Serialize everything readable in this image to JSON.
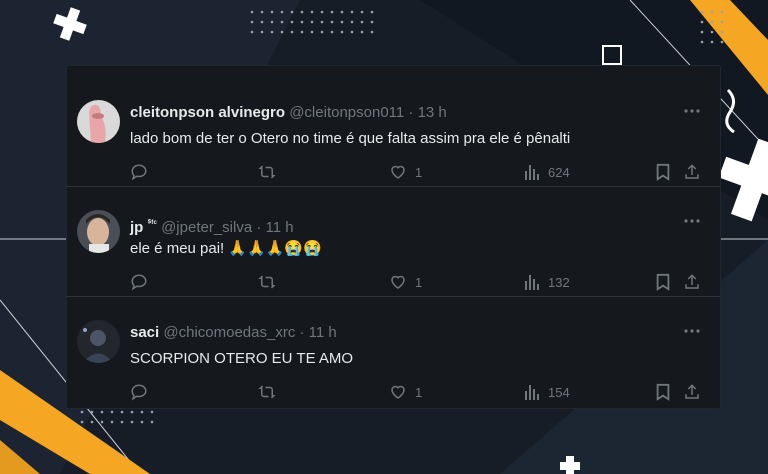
{
  "tweets": [
    {
      "name": "cleitonpson alvinegro",
      "name_suffix": "",
      "handle": "@cleitonpson011",
      "separator": "·",
      "time": "13 h",
      "text": "lado bom de ter o Otero no time é que falta assim pra ele é pênalti",
      "likes": "1",
      "views": "624"
    },
    {
      "name": "jp",
      "name_suffix": "ᔆᶠᶜ",
      "handle": "@jpeter_silva",
      "separator": "·",
      "time": "11 h",
      "text": "ele é meu pai! 🙏🙏🙏😭😭",
      "likes": "1",
      "views": "132"
    },
    {
      "name": "saci",
      "name_suffix": "",
      "handle": "@chicomoedas_xrc",
      "separator": "·",
      "time": "11 h",
      "text": "SCORPION OTERO EU TE AMO",
      "likes": "1",
      "views": "154"
    }
  ],
  "icons": [
    "reply-icon",
    "retweet-icon",
    "like-icon",
    "views-icon",
    "bookmark-icon",
    "share-icon",
    "more-icon"
  ],
  "colors": {
    "accent_yellow": "#f5a623",
    "background": "#161d27",
    "panel": "#15181c",
    "text": "#e7e9ea",
    "muted": "#71767b"
  }
}
